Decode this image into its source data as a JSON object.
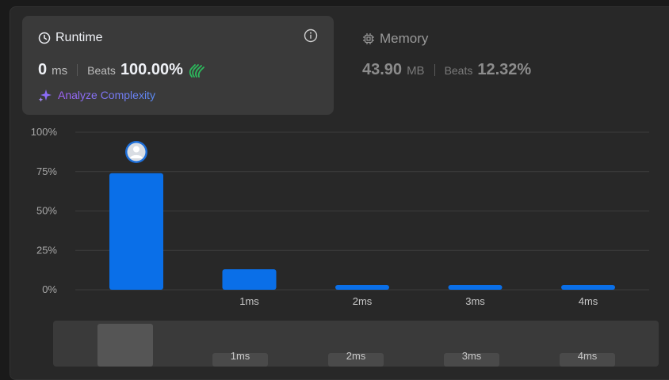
{
  "runtime": {
    "title": "Runtime",
    "value": "0",
    "unit": "ms",
    "beats_label": "Beats",
    "beats_value": "100.00%",
    "analyze_label": "Analyze Complexity"
  },
  "memory": {
    "title": "Memory",
    "value": "43.90",
    "unit": "MB",
    "beats_label": "Beats",
    "beats_value": "12.32%"
  },
  "colors": {
    "bar": "#0a6fe8",
    "accent_green": "#2cbb5d",
    "grid": "#3d3d3d"
  },
  "chart_data": {
    "type": "bar",
    "categories": [
      "0ms",
      "1ms",
      "2ms",
      "3ms",
      "4ms"
    ],
    "category_labels": [
      "",
      "1ms",
      "2ms",
      "3ms",
      "4ms"
    ],
    "values": [
      74,
      13,
      3,
      3,
      3
    ],
    "ylim": [
      0,
      100
    ],
    "yticks": [
      "0%",
      "25%",
      "50%",
      "75%",
      "100%"
    ],
    "highlight_index": 0,
    "grid": true
  },
  "overview": {
    "labels": [
      "1ms",
      "2ms",
      "3ms",
      "4ms"
    ]
  }
}
